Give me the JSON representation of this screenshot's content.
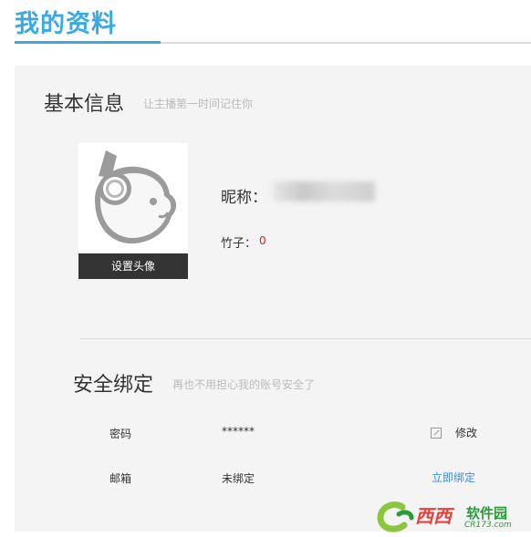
{
  "page": {
    "title": "我的资料"
  },
  "basic": {
    "title": "基本信息",
    "subtitle": "让主播第一时间记住你",
    "avatar_button": "设置头像",
    "nickname_label": "昵称：",
    "nickname_value": "",
    "bamboo_label": "竹子：",
    "bamboo_value": "0"
  },
  "security": {
    "title": "安全绑定",
    "subtitle": "再也不用担心我的账号安全了",
    "rows": [
      {
        "label": "密码",
        "value": "******",
        "action": "修改"
      },
      {
        "label": "邮箱",
        "value": "未绑定",
        "action": "立即绑定"
      }
    ]
  },
  "watermark": {
    "brand": "西西",
    "tagline": "软件园",
    "url": "CR173.com"
  },
  "colors": {
    "accent": "#3aa9e2",
    "link": "#3a8ee6",
    "bamboo": "#e02020",
    "panel": "#f4f4f4"
  }
}
